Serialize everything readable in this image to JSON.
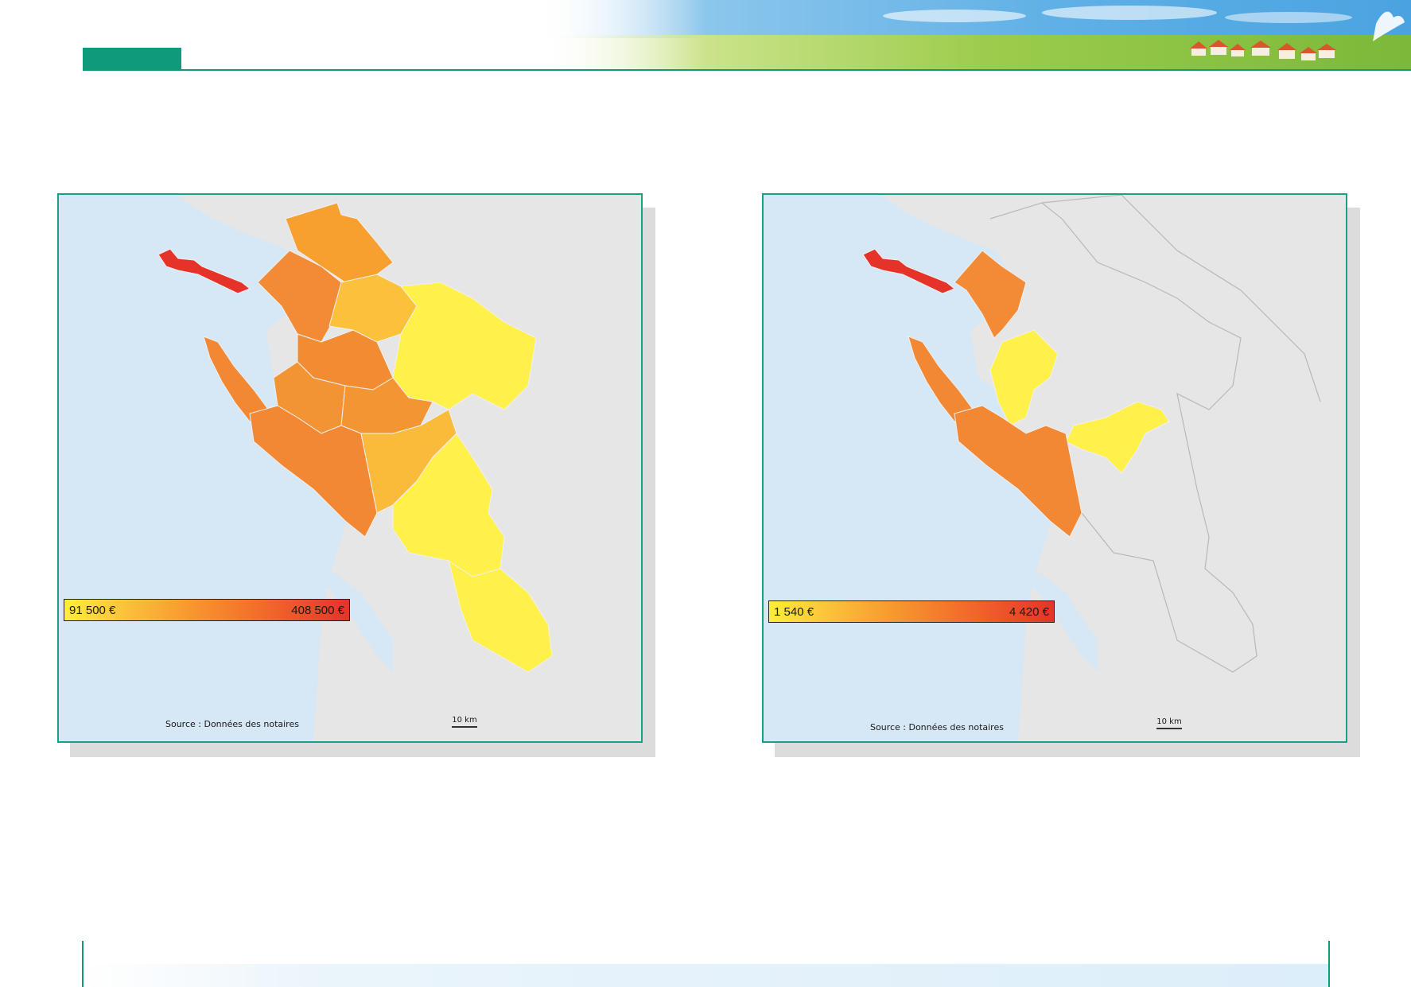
{
  "colors": {
    "accent": "#0f9a7b",
    "panel_border": "#17a085",
    "sea": "#d6e7f5",
    "land": "#e6e6e6",
    "low": "#ffee3a",
    "mid": "#f7962e",
    "high": "#e5332a"
  },
  "maps": [
    {
      "legend": {
        "min_label": "91 500 €",
        "max_label": "408 500 €"
      },
      "source": "Source : Données des notaires",
      "scale_label": "10 km"
    },
    {
      "legend": {
        "min_label": "1 540 €",
        "max_label": "4 420 €"
      },
      "source": "Source : Données des notaires",
      "scale_label": "10 km"
    }
  ]
}
